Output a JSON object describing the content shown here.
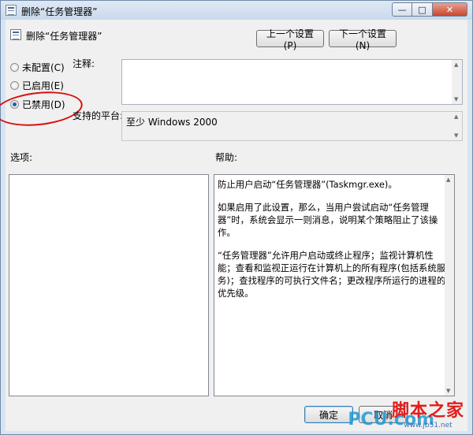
{
  "window": {
    "title": "删除“任务管理器”",
    "buttons": {
      "minimize": "—",
      "maximize": "□",
      "close": "✕"
    }
  },
  "header": {
    "title": "删除“任务管理器”",
    "prev_label": "上一个设置(P)",
    "next_label": "下一个设置(N)"
  },
  "state": {
    "options": [
      {
        "label": "未配置(C)",
        "selected": false
      },
      {
        "label": "已启用(E)",
        "selected": false
      },
      {
        "label": "已禁用(D)",
        "selected": true
      }
    ]
  },
  "comment": {
    "label": "注释:",
    "value": ""
  },
  "platform": {
    "label": "支持的平台:",
    "value": "至少 Windows 2000"
  },
  "options_pane": {
    "label": "选项:"
  },
  "help_pane": {
    "label": "帮助:",
    "paragraphs": [
      "防止用户启动“任务管理器”(Taskmgr.exe)。",
      "如果启用了此设置，那么，当用户尝试启动“任务管理器”时，系统会显示一则消息，说明某个策略阻止了该操作。",
      "“任务管理器”允许用户启动或终止程序；监视计算机性能；查看和监视正运行在计算机上的所有程序(包括系统服务)；查找程序的可执行文件名；更改程序所运行的进程的优先级。"
    ]
  },
  "footer": {
    "ok_label": "确定",
    "cancel_label": "取消"
  },
  "watermark": {
    "brand": "脚本之家",
    "url": "www.jb51.net",
    "pcu": "PCU.com"
  },
  "colors": {
    "annotation": "#d80f0f",
    "titlebar": "#c9d9ec",
    "close_button": "#c7452e"
  },
  "icons": {
    "title": "policy-setting-icon",
    "header": "policy-setting-icon"
  }
}
